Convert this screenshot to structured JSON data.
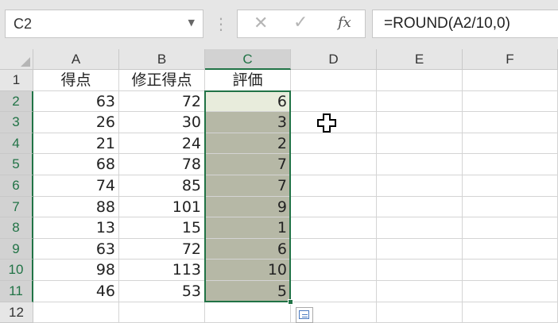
{
  "name_box": {
    "value": "C2"
  },
  "formula_bar": {
    "formula": "=ROUND(A2/10,0)",
    "fx_label": "fx",
    "cancel_icon": "✕",
    "enter_icon": "✓",
    "separator": "⋮"
  },
  "columns": [
    "A",
    "B",
    "C",
    "D",
    "E",
    "F"
  ],
  "selected_column": "C",
  "rows": [
    "1",
    "2",
    "3",
    "4",
    "5",
    "6",
    "7",
    "8",
    "9",
    "10",
    "11",
    "12"
  ],
  "headers": {
    "A": "得点",
    "B": "修正得点",
    "C": "評価"
  },
  "data_rows": [
    {
      "A": "63",
      "B": "72",
      "C": "6"
    },
    {
      "A": "26",
      "B": "30",
      "C": "3"
    },
    {
      "A": "21",
      "B": "24",
      "C": "2"
    },
    {
      "A": "68",
      "B": "78",
      "C": "7"
    },
    {
      "A": "74",
      "B": "85",
      "C": "7"
    },
    {
      "A": "88",
      "B": "101",
      "C": "9"
    },
    {
      "A": "13",
      "B": "15",
      "C": "1"
    },
    {
      "A": "63",
      "B": "72",
      "C": "6"
    },
    {
      "A": "98",
      "B": "113",
      "C": "10"
    },
    {
      "A": "46",
      "B": "53",
      "C": "5"
    }
  ],
  "colors": {
    "accent": "#217346",
    "selection_fill": "#b6b8a6",
    "active_cell_fill": "#e8ecdc"
  },
  "icons": {
    "name_box_dropdown": "dropdown-arrow-icon",
    "cursor": "plus-cursor-icon",
    "quick_analysis": "quick-analysis-icon"
  }
}
